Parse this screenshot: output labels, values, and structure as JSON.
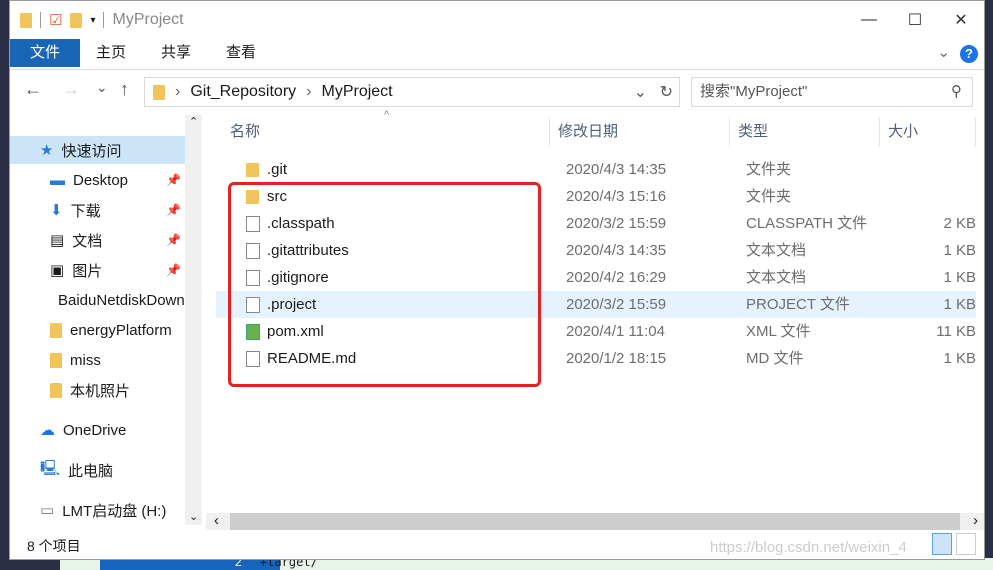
{
  "window": {
    "title": "MyProject",
    "minimize": "—",
    "maximize": "☐",
    "close": "✕"
  },
  "ribbon": {
    "tabs": [
      "文件",
      "主页",
      "共享",
      "查看"
    ],
    "help": "?"
  },
  "nav": {
    "back": "←",
    "forward": "→",
    "recent": "⌄",
    "up": "↑",
    "breadcrumb": [
      "Git_Repository",
      "MyProject"
    ],
    "search_placeholder": "搜索\"MyProject\""
  },
  "sidebar": [
    {
      "label": "快速访问",
      "icon": "star-icon"
    },
    {
      "label": "Desktop",
      "icon": "desktop-icon",
      "pinned": true
    },
    {
      "label": "下载",
      "icon": "download-icon",
      "pinned": true
    },
    {
      "label": "文档",
      "icon": "document-icon",
      "pinned": true
    },
    {
      "label": "图片",
      "icon": "picture-icon",
      "pinned": true
    },
    {
      "label": "BaiduNetdiskDownload",
      "icon": "folder-icon"
    },
    {
      "label": "energyPlatform",
      "icon": "folder-icon"
    },
    {
      "label": "miss",
      "icon": "folder-icon"
    },
    {
      "label": "本机照片",
      "icon": "folder-icon"
    },
    {
      "label": "OneDrive",
      "icon": "cloud-icon"
    },
    {
      "label": "此电脑",
      "icon": "computer-icon"
    },
    {
      "label": "LMT启动盘 (H:)",
      "icon": "drive-icon"
    }
  ],
  "columns": [
    "名称",
    "修改日期",
    "类型",
    "大小"
  ],
  "files": [
    {
      "name": ".git",
      "date": "2020/4/3 14:35",
      "type": "文件夹",
      "size": "",
      "icon": "folder"
    },
    {
      "name": "src",
      "date": "2020/4/3 15:16",
      "type": "文件夹",
      "size": "",
      "icon": "folder"
    },
    {
      "name": ".classpath",
      "date": "2020/3/2 15:59",
      "type": "CLASSPATH 文件",
      "size": "2 KB",
      "icon": "file"
    },
    {
      "name": ".gitattributes",
      "date": "2020/4/3 14:35",
      "type": "文本文档",
      "size": "1 KB",
      "icon": "text"
    },
    {
      "name": ".gitignore",
      "date": "2020/4/2 16:29",
      "type": "文本文档",
      "size": "1 KB",
      "icon": "text"
    },
    {
      "name": ".project",
      "date": "2020/3/2 15:59",
      "type": "PROJECT 文件",
      "size": "1 KB",
      "icon": "file"
    },
    {
      "name": "pom.xml",
      "date": "2020/4/1 11:04",
      "type": "XML 文件",
      "size": "11 KB",
      "icon": "xml"
    },
    {
      "name": "README.md",
      "date": "2020/1/2 18:15",
      "type": "MD 文件",
      "size": "1 KB",
      "icon": "file"
    }
  ],
  "status": {
    "count": "8 个项目"
  },
  "watermark": "https://blog.csdn.net/weixin_4",
  "background": {
    "line_num": "2",
    "code": "+target/"
  }
}
